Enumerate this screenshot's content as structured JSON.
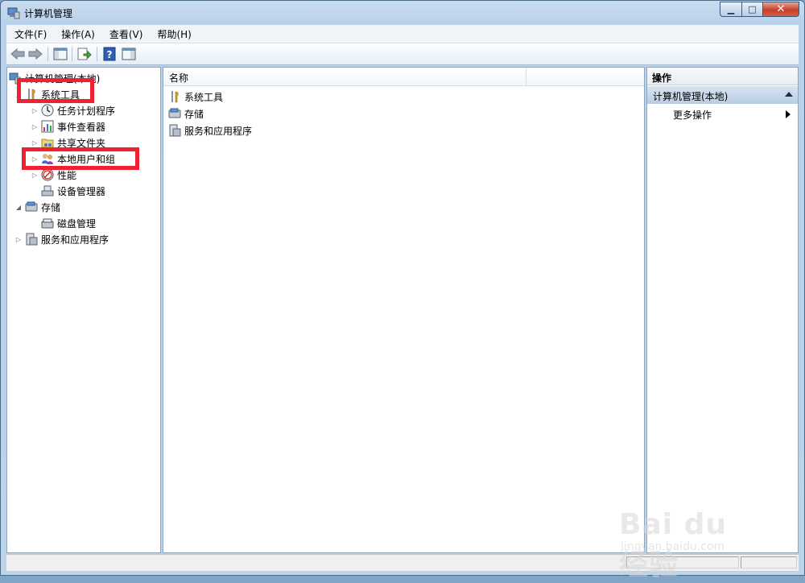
{
  "window": {
    "title": "计算机管理"
  },
  "menu": [
    "文件(F)",
    "操作(A)",
    "查看(V)",
    "帮助(H)"
  ],
  "toolbar_icons": [
    "back-arrow-icon",
    "forward-arrow-icon",
    "show-hide-tree-icon",
    "export-list-icon",
    "help-icon",
    "show-hide-action-pane-icon"
  ],
  "tree": {
    "root": "计算机管理(本地)",
    "system_tools": "系统工具",
    "task_scheduler": "任务计划程序",
    "event_viewer": "事件查看器",
    "shared_folders": "共享文件夹",
    "local_users_groups": "本地用户和组",
    "performance": "性能",
    "device_manager": "设备管理器",
    "storage": "存储",
    "disk_management": "磁盘管理",
    "services_apps": "服务和应用程序"
  },
  "list": {
    "col_name": "名称",
    "items": [
      "系统工具",
      "存储",
      "服务和应用程序"
    ]
  },
  "actions": {
    "title": "操作",
    "group": "计算机管理(本地)",
    "more": "更多操作"
  },
  "watermark": {
    "logo": "Bai du 经验",
    "sub": "jingyan.baidu.com"
  },
  "colors": {
    "highlight": "#ee2233",
    "action_group": "#b8cde3"
  }
}
